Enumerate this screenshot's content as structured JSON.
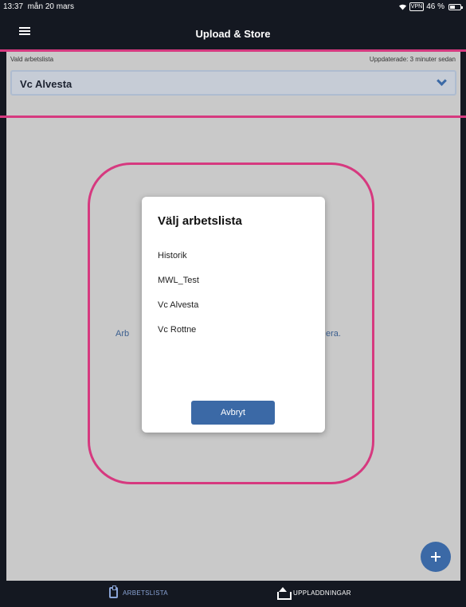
{
  "status_bar": {
    "time": "13:37",
    "date": "mån 20 mars",
    "wifi": "wifi-icon",
    "vpn": "VPN",
    "battery": "46 %"
  },
  "app_bar": {
    "title": "Upload & Store",
    "menu_icon": "menu-icon"
  },
  "worklist_header": {
    "caption": "Vald arbetslista",
    "updated": "Uppdaterade: 3 minuter sedan",
    "selected": "Vc Alvesta"
  },
  "background_message": {
    "left_fragment": "Arb",
    "right_fragment": "era."
  },
  "dialog": {
    "title": "Välj arbetslista",
    "options": [
      "Historik",
      "MWL_Test",
      "Vc Alvesta",
      "Vc Rottne"
    ],
    "cancel_label": "Avbryt"
  },
  "fab": {
    "icon": "plus-icon"
  },
  "bottom_nav": {
    "items": [
      {
        "label": "ARBETSLISTA",
        "icon": "clipboard-icon",
        "active": true
      },
      {
        "label": "UPPLADDNINGAR",
        "icon": "upload-icon",
        "active": false
      }
    ]
  },
  "colors": {
    "accent": "#3b69a6",
    "highlight": "#d6397f",
    "background": "#c9c9c9",
    "bar": "#141821"
  }
}
